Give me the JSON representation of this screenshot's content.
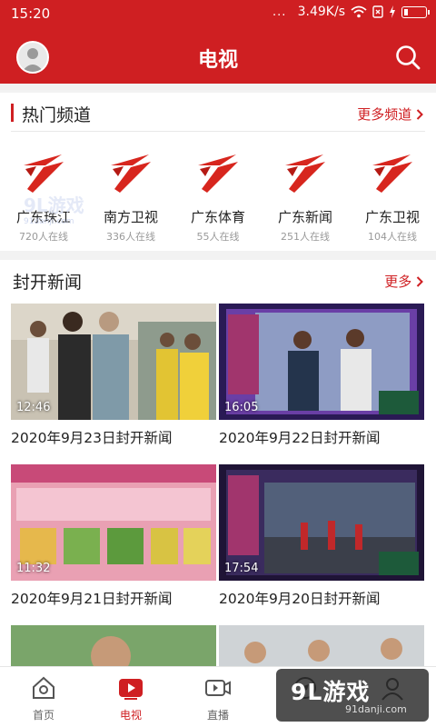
{
  "status_bar": {
    "time": "15:20",
    "dots": "...",
    "speed": "3.49K/s"
  },
  "header": {
    "title": "电视"
  },
  "hot_channels": {
    "title": "热门频道",
    "more": "更多频道",
    "items": [
      {
        "name": "广东珠江",
        "count": "720人在线"
      },
      {
        "name": "南方卫视",
        "count": "336人在线"
      },
      {
        "name": "广东体育",
        "count": "55人在线"
      },
      {
        "name": "广东新闻",
        "count": "251人在线"
      },
      {
        "name": "广东卫视",
        "count": "104人在线"
      }
    ]
  },
  "news": {
    "title": "封开新闻",
    "more": "更多",
    "items": [
      {
        "duration": "12:46",
        "title": "2020年9月23日封开新闻"
      },
      {
        "duration": "16:05",
        "title": "2020年9月22日封开新闻"
      },
      {
        "duration": "11:32",
        "title": "2020年9月21日封开新闻"
      },
      {
        "duration": "17:54",
        "title": "2020年9月20日封开新闻"
      }
    ]
  },
  "watermark": {
    "brand": "9L游戏",
    "site": "91danji.com"
  },
  "bottom_nav": [
    {
      "label": "首页"
    },
    {
      "label": "电视"
    },
    {
      "label": "直播"
    },
    {
      "label": ""
    },
    {
      "label": ""
    }
  ],
  "badge": {
    "brand": "9L游戏",
    "site": "91danji.com"
  },
  "colors": {
    "brand_red": "#cf1f22",
    "text": "#222222",
    "muted": "#999999",
    "background": "#ffffff"
  }
}
